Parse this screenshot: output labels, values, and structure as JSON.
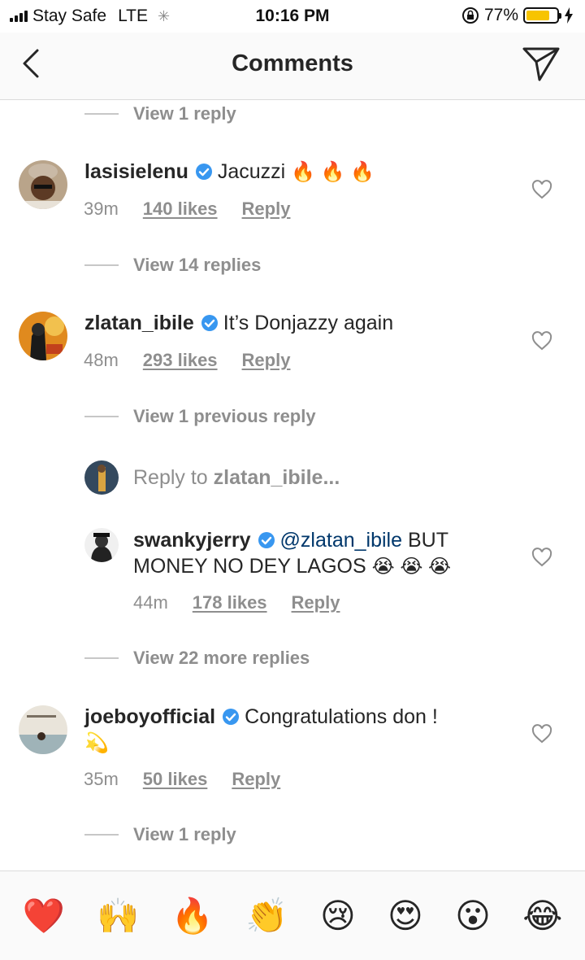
{
  "status_bar": {
    "carrier": "Stay Safe",
    "network": "LTE",
    "time": "10:16 PM",
    "battery": "77%",
    "battery_fraction": 0.77
  },
  "header": {
    "title": "Comments"
  },
  "comments": [
    {
      "view_replies_above": "View 1 reply"
    },
    {
      "username": "lasisielenu",
      "text": "Jacuzzi",
      "emoji": "🔥 🔥 🔥",
      "time": "39m",
      "likes": "140 likes",
      "reply": "Reply",
      "view_replies": "View 14 replies"
    },
    {
      "username": "zlatan_ibile",
      "text": "It’s  Donjazzy again",
      "time": "48m",
      "likes": "293 likes",
      "reply": "Reply",
      "view_previous": "View 1 previous reply",
      "reply_to_prefix": "Reply to",
      "reply_to_user": "zlatan_ibile...",
      "nested": {
        "username": "swankyjerry",
        "mention": "@zlatan_ibile",
        "text_1": " BUT",
        "text_2": "MONEY NO DEY LAGOS",
        "emoji": "😭 😭 😭",
        "time": "44m",
        "likes": "178 likes",
        "reply": "Reply"
      },
      "view_more": "View 22 more replies"
    },
    {
      "username": "joeboyofficial",
      "text": "Congratulations don !",
      "emoji": "💫",
      "time": "35m",
      "likes": "50 likes",
      "reply": "Reply",
      "view_replies": "View 1 reply"
    }
  ],
  "quick_emojis": [
    "❤️",
    "🙌",
    "🔥",
    "👏",
    "😢",
    "😍",
    "😮",
    "😂"
  ]
}
